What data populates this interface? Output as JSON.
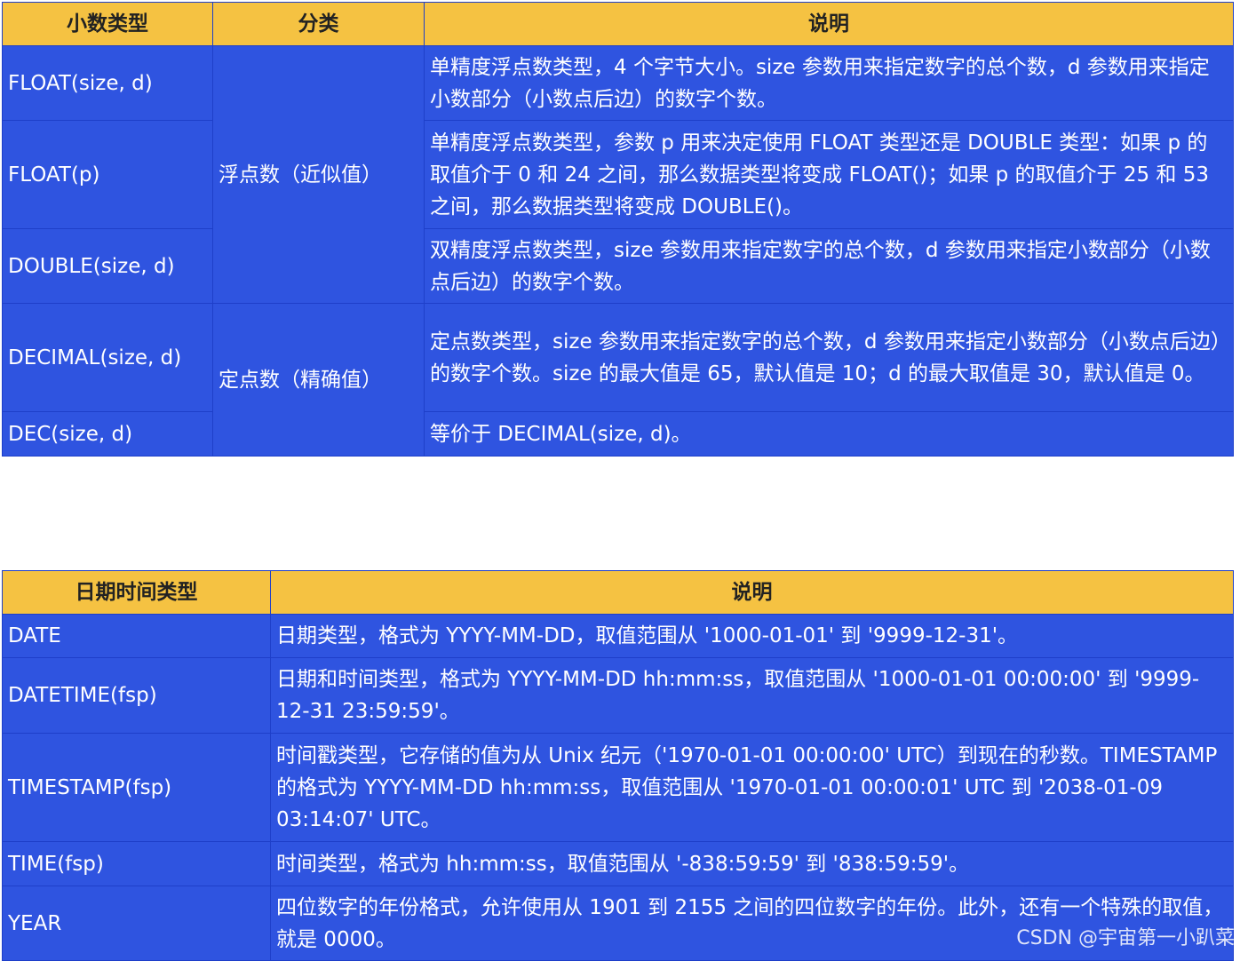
{
  "decimal_table": {
    "headers": [
      "小数类型",
      "分类",
      "说明"
    ],
    "rows": [
      {
        "type": "FLOAT(size, d)",
        "desc": "单精度浮点数类型，4 个字节大小。size 参数用来指定数字的总个数，d 参数用来指定小数部分（小数点后边）的数字个数。"
      },
      {
        "type": "FLOAT(p)",
        "desc": "单精度浮点数类型，参数 p 用来决定使用 FLOAT 类型还是 DOUBLE 类型：如果 p 的取值介于 0 和 24 之间，那么数据类型将变成 FLOAT()；如果 p 的取值介于 25 和 53 之间，那么数据类型将变成 DOUBLE()。"
      },
      {
        "type": "DOUBLE(size, d)",
        "desc": "双精度浮点数类型，size 参数用来指定数字的总个数，d 参数用来指定小数部分（小数点后边）的数字个数。"
      },
      {
        "type": "DECIMAL(size, d)",
        "desc": "定点数类型，size 参数用来指定数字的总个数，d 参数用来指定小数部分（小数点后边）的数字个数。size 的最大值是 65，默认值是 10；d 的最大取值是 30，默认值是 0。"
      },
      {
        "type": "DEC(size, d)",
        "desc": "等价于 DECIMAL(size, d)。"
      }
    ],
    "categories": [
      "浮点数（近似值）",
      "定点数（精确值）"
    ]
  },
  "datetime_table": {
    "headers": [
      "日期时间类型",
      "说明"
    ],
    "rows": [
      {
        "type": "DATE",
        "desc": "日期类型，格式为 YYYY-MM-DD，取值范围从 '1000-01-01' 到 '9999-12-31'。"
      },
      {
        "type": "DATETIME(fsp)",
        "desc": "日期和时间类型，格式为 YYYY-MM-DD hh:mm:ss，取值范围从 '1000-01-01 00:00:00' 到 '9999-12-31 23:59:59'。"
      },
      {
        "type": "TIMESTAMP(fsp)",
        "desc": "时间戳类型，它存储的值为从 Unix 纪元（'1970-01-01 00:00:00' UTC）到现在的秒数。TIMESTAMP 的格式为 YYYY-MM-DD hh:mm:ss，取值范围从 '1970-01-01 00:00:01' UTC 到 '2038-01-09 03:14:07' UTC。"
      },
      {
        "type": "TIME(fsp)",
        "desc": "时间类型，格式为 hh:mm:ss，取值范围从 '-838:59:59' 到 '838:59:59'。"
      },
      {
        "type": "YEAR",
        "desc": "四位数字的年份格式，允许使用从 1901 到 2155 之间的四位数字的年份。此外，还有一个特殊的取值，就是 0000。"
      }
    ]
  },
  "watermark": "CSDN @宇宙第一小趴菜",
  "colors": {
    "header_bg": "#f5c242",
    "cell_bg": "#2f54e0",
    "border": "#1e3fc9"
  }
}
